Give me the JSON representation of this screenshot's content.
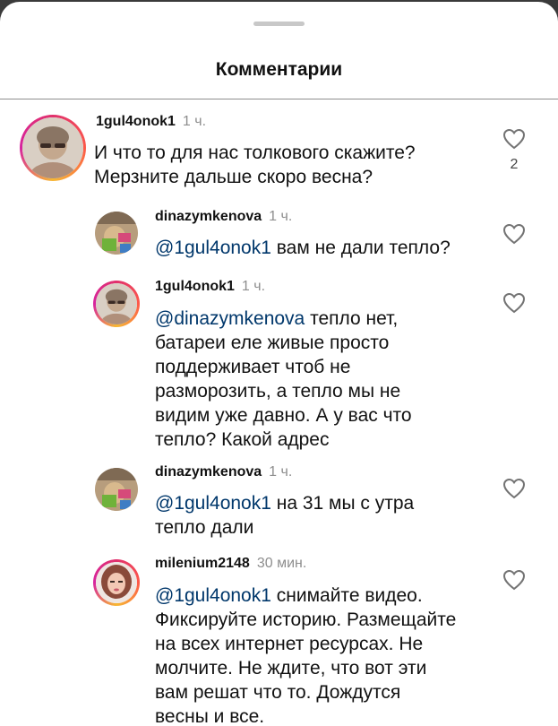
{
  "sheet": {
    "title": "Комментарии"
  },
  "comments": [
    {
      "username": "1gul4onok1",
      "time": "1 ч.",
      "line1": "И что то для нас толкового скажите?",
      "line2": "Мерзните дальше скоро весна?",
      "likes": "2",
      "avatar": "avatar-photo-gul"
    },
    {
      "username": "dinazymkenova",
      "time": "1 ч.",
      "mention": "@1gul4onok1",
      "text": " вам не дали тепло?",
      "avatar": "avatar-photo-dinazym"
    },
    {
      "username": "1gul4onok1",
      "time": "1 ч.",
      "mention": "@dinazymkenova",
      "line1_rest": " тепло нет,",
      "line2": "батареи еле живые просто",
      "line3": "поддерживает чтоб не",
      "line4": "разморозить, а тепло мы не",
      "line5": "видим уже давно. А у вас что",
      "line6": "тепло? Какой адрес",
      "avatar": "avatar-photo-gul"
    },
    {
      "username": "dinazymkenova",
      "time": "1 ч.",
      "mention": "@1gul4onok1",
      "line1_rest": " на 31 мы с утра",
      "line2": "тепло дали",
      "avatar": "avatar-photo-dinazym"
    },
    {
      "username": "milenium2148",
      "time": "30 мин.",
      "mention": "@1gul4onok1",
      "line1_rest": " снимайте видео.",
      "line2": "Фиксируйте историю. Размещайте",
      "line3": "на всех интернет ресурсах. Не",
      "line4": "молчите. Не ждите, что вот эти",
      "line5": "вам решат что то. Дождутся",
      "line6": "весны и все.",
      "avatar": "avatar-photo-milenium"
    }
  ],
  "colors": {
    "mention": "#00376b",
    "muted": "#8e8e8e",
    "ring": "#e1306c"
  },
  "icons": {
    "like": "heart-outline-icon"
  }
}
